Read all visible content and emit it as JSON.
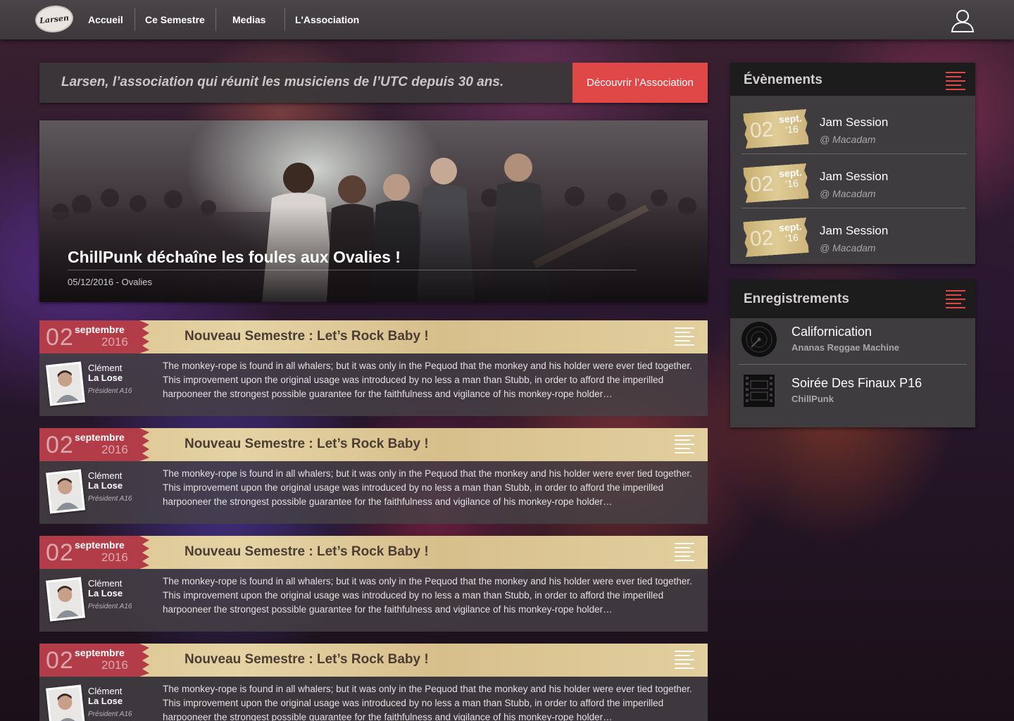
{
  "nav": {
    "logo_text": "Larsen",
    "items": [
      {
        "label": "Accueil"
      },
      {
        "label": "Ce Semestre"
      },
      {
        "label": "Medias"
      },
      {
        "label": "L'Association"
      }
    ]
  },
  "tagline": {
    "text": "Larsen, l’association qui réunit les musiciens de l’UTC depuis 30 ans.",
    "button_label": "Découvrir l’Association"
  },
  "featured": {
    "title": "ChillPunk déchaîne les foules aux Ovalies !",
    "meta": "05/12/2016 - Ovalies"
  },
  "articles": [
    {
      "day": "02",
      "month": "septembre",
      "year": "2016",
      "title": "Nouveau Semestre : Let’s Rock Baby !",
      "author_first": "Clément",
      "author_last": "La Lose",
      "author_role": "Président A16",
      "text": "The monkey-rope is found in all whalers; but it was only in the Pequod that the monkey and his holder were ever tied together. This improvement upon the original usage was introduced by no less a man than Stubb, in order to afford the imperilled harpooneer the strongest possible guarantee for the faithfulness and vigilance of his monkey-rope holder…"
    },
    {
      "day": "02",
      "month": "septembre",
      "year": "2016",
      "title": "Nouveau Semestre : Let’s Rock Baby !",
      "author_first": "Clément",
      "author_last": "La Lose",
      "author_role": "Président A16",
      "text": "The monkey-rope is found in all whalers; but it was only in the Pequod that the monkey and his holder were ever tied together. This improvement upon the original usage was introduced by no less a man than Stubb, in order to afford the imperilled harpooneer the strongest possible guarantee for the faithfulness and vigilance of his monkey-rope holder…"
    },
    {
      "day": "02",
      "month": "septembre",
      "year": "2016",
      "title": "Nouveau Semestre : Let’s Rock Baby !",
      "author_first": "Clément",
      "author_last": "La Lose",
      "author_role": "Président A16",
      "text": "The monkey-rope is found in all whalers; but it was only in the Pequod that the monkey and his holder were ever tied together. This improvement upon the original usage was introduced by no less a man than Stubb, in order to afford the imperilled harpooneer the strongest possible guarantee for the faithfulness and vigilance of his monkey-rope holder…"
    },
    {
      "day": "02",
      "month": "septembre",
      "year": "2016",
      "title": "Nouveau Semestre : Let’s Rock Baby !",
      "author_first": "Clément",
      "author_last": "La Lose",
      "author_role": "Président A16",
      "text": "The monkey-rope is found in all whalers; but it was only in the Pequod that the monkey and his holder were ever tied together. This improvement upon the original usage was introduced by no less a man than Stubb, in order to afford the imperilled harpooneer the strongest possible guarantee for the faithfulness and vigilance of his monkey-rope holder…"
    }
  ],
  "events_panel": {
    "title": "Évènements",
    "events": [
      {
        "day": "02",
        "month": "sept.",
        "year": "‘16",
        "name": "Jam Session",
        "venue": "@ Macadam"
      },
      {
        "day": "02",
        "month": "sept.",
        "year": "‘16",
        "name": "Jam Session",
        "venue": "@ Macadam"
      },
      {
        "day": "02",
        "month": "sept.",
        "year": "‘16",
        "name": "Jam Session",
        "venue": "@ Macadam"
      }
    ]
  },
  "recordings_panel": {
    "title": "Enregistrements",
    "items": [
      {
        "title": "Californication",
        "artist": "Ananas Reggae Machine",
        "icon": "vinyl-icon"
      },
      {
        "title": "Soirée Des Finaux P16",
        "artist": "ChillPunk",
        "icon": "film-icon"
      }
    ]
  },
  "colors": {
    "accent_red": "#e04848",
    "date_red": "#b23c48",
    "parchment": "#dcc592",
    "panel_dark": "#1d1c1d",
    "panel": "#3e3c3e"
  }
}
